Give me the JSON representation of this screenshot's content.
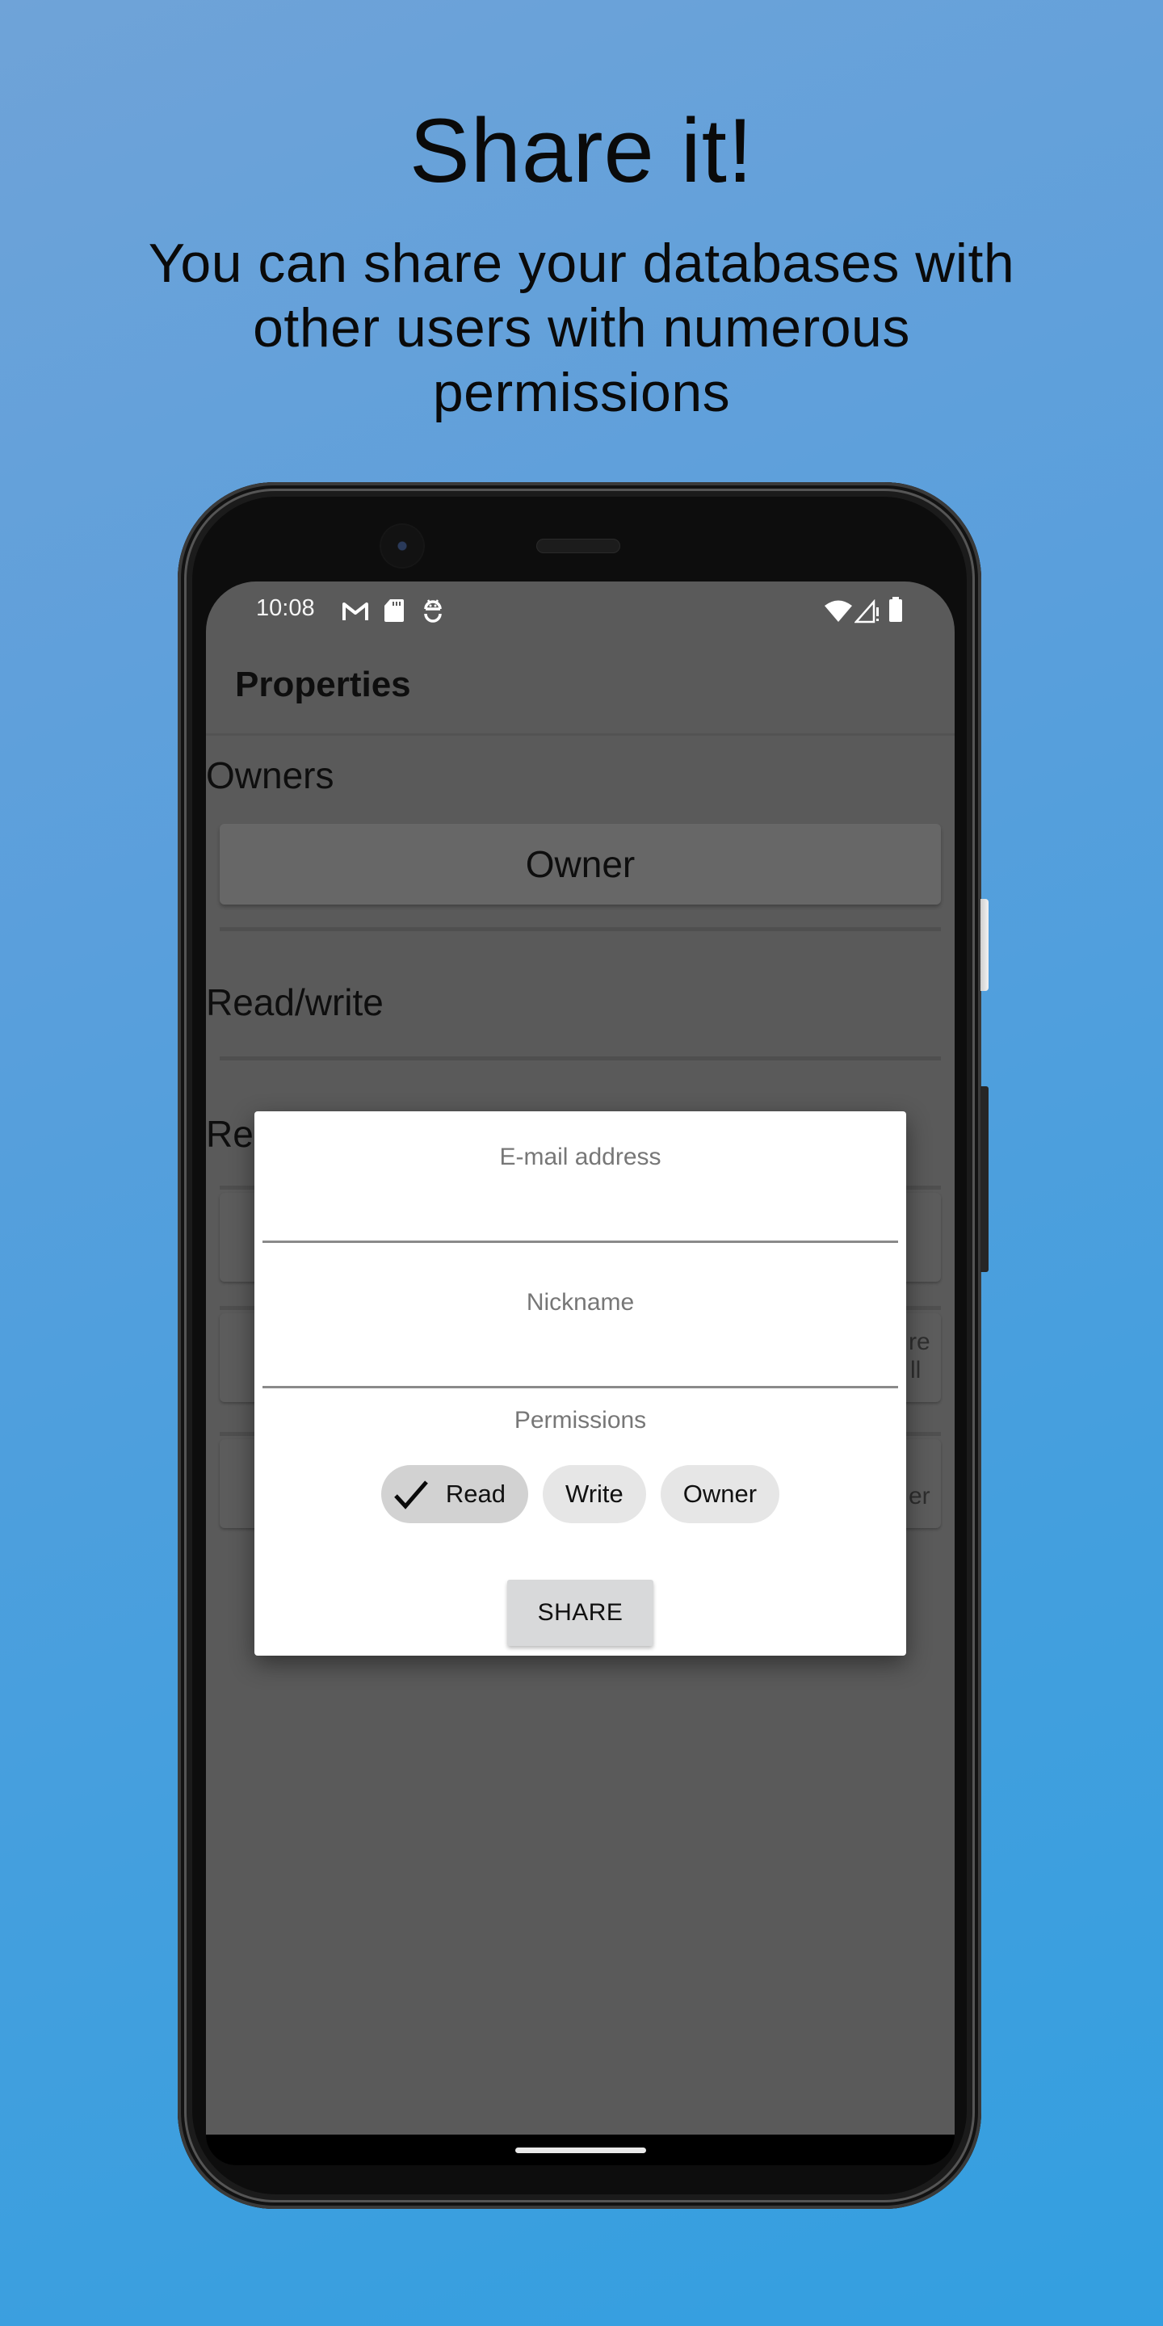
{
  "promo": {
    "title": "Share it!",
    "subtitle": "You can share your databases with other users with numerous permissions"
  },
  "status_bar": {
    "time": "10:08",
    "left_icons": [
      "gmail-icon",
      "sd-card-icon",
      "android-debug-icon"
    ],
    "right_icons": [
      "wifi-icon",
      "cell-signal-no-data-icon",
      "battery-icon"
    ]
  },
  "app": {
    "toolbar_title": "Properties",
    "sections": {
      "owners_label": "Owners",
      "owner_button": "Owner",
      "read_write_label": "Read/write",
      "read_label_fragment": "Re"
    },
    "background_fragments": [
      "re",
      "ll",
      "er"
    ]
  },
  "dialog": {
    "email": {
      "label": "E-mail address",
      "value": ""
    },
    "nickname": {
      "label": "Nickname",
      "value": ""
    },
    "permissions_label": "Permissions",
    "permission_chips": [
      {
        "label": "Read",
        "selected": true
      },
      {
        "label": "Write",
        "selected": false
      },
      {
        "label": "Owner",
        "selected": false
      }
    ],
    "share_button": "SHARE"
  }
}
